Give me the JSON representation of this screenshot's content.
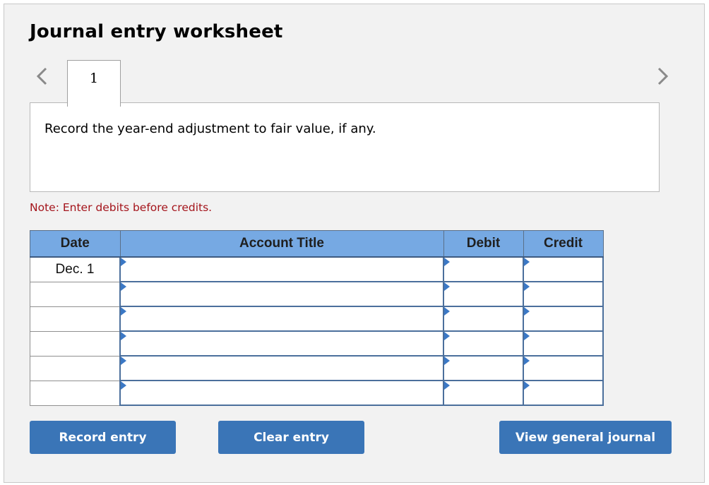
{
  "worksheet": {
    "title": "Journal entry worksheet",
    "nav": {
      "prev_icon": "chevron-left-icon",
      "next_icon": "chevron-right-icon"
    },
    "tabs": [
      {
        "label": "1",
        "active": true
      }
    ],
    "question": "Record the year-end adjustment to fair value, if any.",
    "note": "Note: Enter debits before credits.",
    "colors": {
      "header_bg": "#76a9e3",
      "button_bg": "#3a75b7",
      "note_text": "#a4141b"
    }
  },
  "table": {
    "headers": {
      "date": "Date",
      "account": "Account Title",
      "debit": "Debit",
      "credit": "Credit"
    },
    "rows": [
      {
        "date": "Dec. 1",
        "account": "",
        "debit": "",
        "credit": ""
      },
      {
        "date": "",
        "account": "",
        "debit": "",
        "credit": ""
      },
      {
        "date": "",
        "account": "",
        "debit": "",
        "credit": ""
      },
      {
        "date": "",
        "account": "",
        "debit": "",
        "credit": ""
      },
      {
        "date": "",
        "account": "",
        "debit": "",
        "credit": ""
      },
      {
        "date": "",
        "account": "",
        "debit": "",
        "credit": ""
      }
    ]
  },
  "buttons": {
    "record": "Record entry",
    "clear": "Clear entry",
    "view": "View general journal"
  }
}
